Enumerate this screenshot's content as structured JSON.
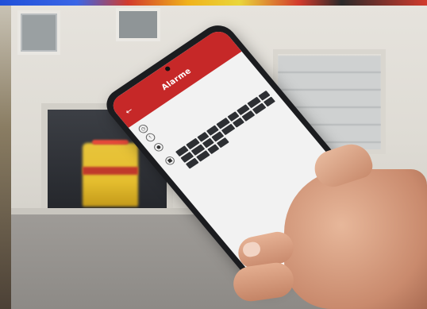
{
  "phone_app": {
    "header": {
      "title": "Alarme",
      "status_left": "",
      "status_right": ""
    },
    "lines": [
      {
        "icon": "clock-icon",
        "text": ""
      },
      {
        "icon": "alert-icon",
        "text": ""
      },
      {
        "icon": "pin-icon",
        "text": ""
      },
      {
        "icon": "truck-icon",
        "text": ""
      }
    ],
    "acknowledge_button": "",
    "bottom_nav": [
      "home-icon",
      "list-icon",
      "map-icon",
      "settings-icon"
    ]
  }
}
